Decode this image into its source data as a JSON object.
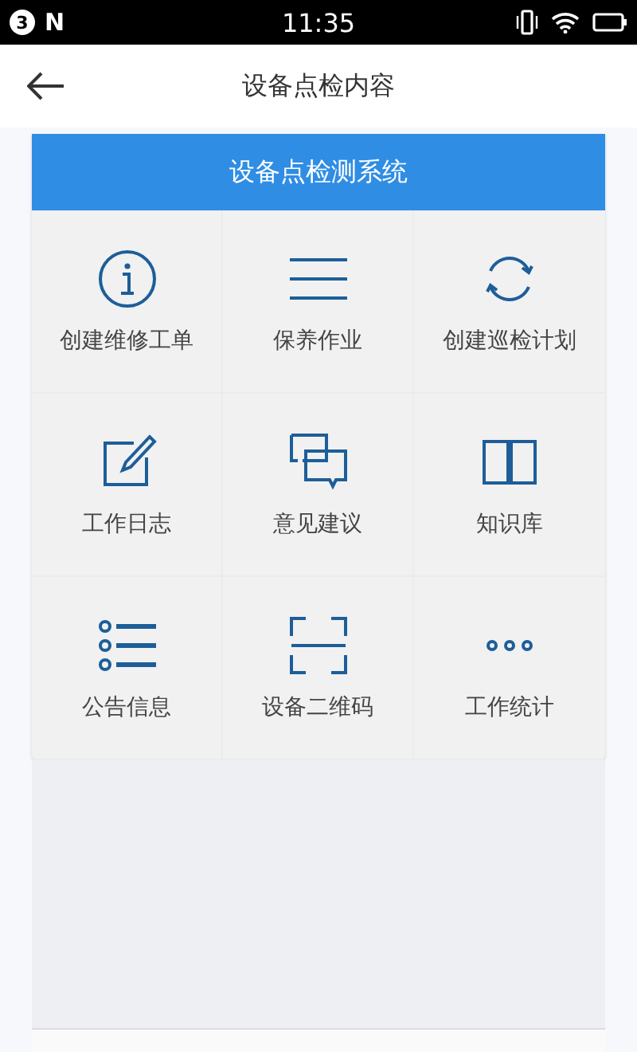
{
  "status_bar": {
    "badge": "3",
    "logo": "N",
    "time": "11:35"
  },
  "header": {
    "title": "设备点检内容"
  },
  "panel": {
    "title": "设备点检测系统",
    "items": [
      {
        "label": "创建维修工单",
        "kind": "info"
      },
      {
        "label": "保养作业",
        "kind": "menu"
      },
      {
        "label": "创建巡检计划",
        "kind": "refresh"
      },
      {
        "label": "工作日志",
        "kind": "edit"
      },
      {
        "label": "意见建议",
        "kind": "chat"
      },
      {
        "label": "知识库",
        "kind": "book"
      },
      {
        "label": "公告信息",
        "kind": "list"
      },
      {
        "label": "设备二维码",
        "kind": "scan"
      },
      {
        "label": "工作统计",
        "kind": "more"
      }
    ]
  }
}
